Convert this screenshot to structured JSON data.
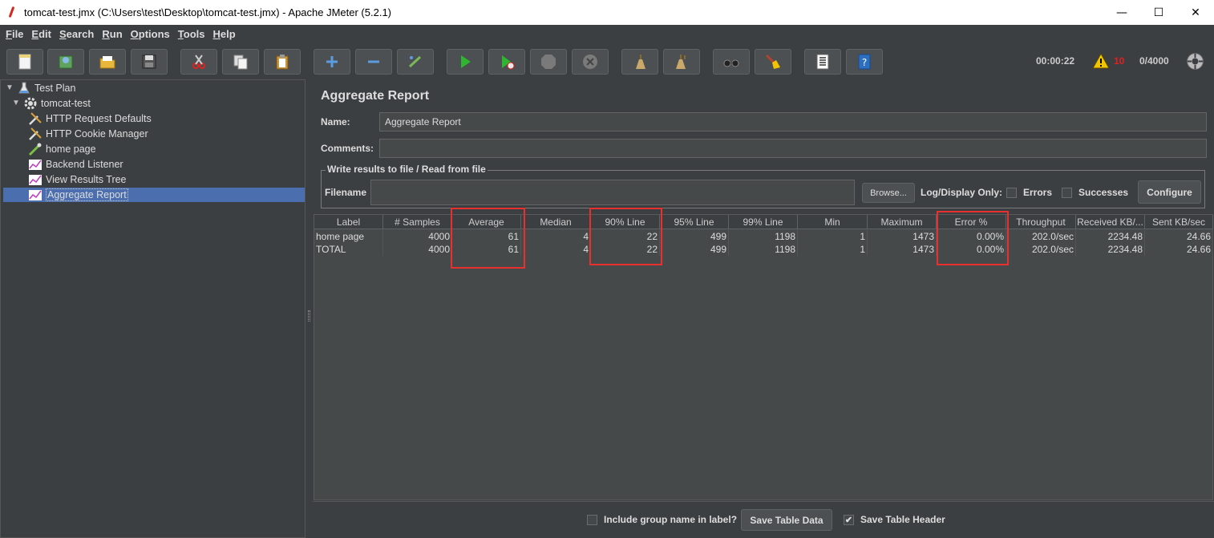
{
  "window": {
    "title": "tomcat-test.jmx (C:\\Users\\test\\Desktop\\tomcat-test.jmx) - Apache JMeter (5.2.1)",
    "minimize": "—",
    "maximize": "☐",
    "close": "✕"
  },
  "menu": [
    {
      "key": "F",
      "rest": "ile"
    },
    {
      "key": "E",
      "rest": "dit"
    },
    {
      "key": "S",
      "rest": "earch"
    },
    {
      "key": "R",
      "rest": "un"
    },
    {
      "key": "O",
      "rest": "ptions"
    },
    {
      "key": "T",
      "rest": "ools"
    },
    {
      "key": "H",
      "rest": "elp"
    }
  ],
  "toolbar": {
    "icons": [
      "new-icon",
      "templates-icon",
      "open-icon",
      "save-icon",
      "cut-icon",
      "copy-icon",
      "paste-icon",
      "expand-icon",
      "collapse-icon",
      "toggle-icon",
      "start-icon",
      "start-no-timers-icon",
      "stop-icon",
      "shutdown-icon",
      "clear-icon",
      "clear-all-icon",
      "search-icon",
      "reset-search-icon",
      "function-helper-icon",
      "help-icon"
    ],
    "elapsed": "00:00:22",
    "warning_count": "10",
    "threads": "0/4000",
    "colors": {
      "play": "#2fb52f",
      "warn": "#f2c500",
      "error": "#e02020"
    }
  },
  "tree": [
    {
      "label": "Test Plan",
      "icon": "flask-icon",
      "arrow": "▼"
    },
    {
      "label": "tomcat-test",
      "icon": "gear-icon",
      "arrow": "▼"
    },
    {
      "label": "HTTP Request Defaults",
      "icon": "wrench-icon"
    },
    {
      "label": "HTTP Cookie Manager",
      "icon": "wrench-icon"
    },
    {
      "label": "home page",
      "icon": "pipette-icon"
    },
    {
      "label": "Backend Listener",
      "icon": "graph-icon"
    },
    {
      "label": "View Results Tree",
      "icon": "graph-icon"
    },
    {
      "label": "Aggregate Report",
      "icon": "graph-icon",
      "selected": true
    }
  ],
  "panel": {
    "title": "Aggregate Report",
    "name_label": "Name:",
    "name_value": "Aggregate Report",
    "comments_label": "Comments:",
    "comments_value": "",
    "file_group_title": "Write results to file / Read from file",
    "filename_label": "Filename",
    "filename_value": "",
    "browse_button": "Browse...",
    "log_display_label": "Log/Display Only:",
    "errors_label": "Errors",
    "successes_label": "Successes",
    "configure_button": "Configure"
  },
  "table": {
    "headers": [
      "Label",
      "# Samples",
      "Average",
      "Median",
      "90% Line",
      "95% Line",
      "99% Line",
      "Min",
      "Maximum",
      "Error %",
      "Throughput",
      "Received KB/...",
      "Sent KB/sec"
    ],
    "rows": [
      [
        "home page",
        "4000",
        "61",
        "4",
        "22",
        "499",
        "1198",
        "1",
        "1473",
        "0.00%",
        "202.0/sec",
        "2234.48",
        "24.66"
      ],
      [
        "TOTAL",
        "4000",
        "61",
        "4",
        "22",
        "499",
        "1198",
        "1",
        "1473",
        "0.00%",
        "202.0/sec",
        "2234.48",
        "24.66"
      ]
    ],
    "highlighted_columns": [
      "Average",
      "90% Line",
      "Error %"
    ],
    "highlight_color": "#e8302e"
  },
  "bottom": {
    "include_group_label": "Include group name in label?",
    "include_group_checked": false,
    "save_table_data": "Save Table Data",
    "save_table_header_label": "Save Table Header",
    "save_table_header_checked": true,
    "check_mark": "✔"
  }
}
